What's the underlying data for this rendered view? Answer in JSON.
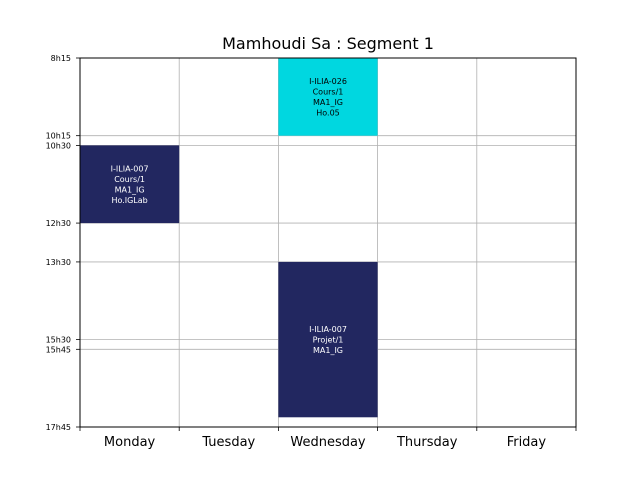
{
  "chart_data": {
    "type": "timetable",
    "title": "Mamhoudi Sa : Segment 1",
    "days": [
      "Monday",
      "Tuesday",
      "Wednesday",
      "Thursday",
      "Friday"
    ],
    "time_ticks": [
      {
        "label": "8h15",
        "minutes": 495
      },
      {
        "label": "10h15",
        "minutes": 615
      },
      {
        "label": "10h30",
        "minutes": 630
      },
      {
        "label": "12h30",
        "minutes": 750
      },
      {
        "label": "13h30",
        "minutes": 810
      },
      {
        "label": "15h30",
        "minutes": 930
      },
      {
        "label": "15h45",
        "minutes": 945
      },
      {
        "label": "17h45",
        "minutes": 1065
      }
    ],
    "ylim": [
      495,
      1065
    ],
    "grid": true,
    "events": [
      {
        "day": "Wednesday",
        "start": "8h15",
        "end": "10h15",
        "start_min": 495,
        "end_min": 615,
        "color": "#00d7e0",
        "text_color": "#000000",
        "lines": [
          "I-ILIA-026",
          "Cours/1",
          "MA1_IG",
          "Ho.05"
        ]
      },
      {
        "day": "Monday",
        "start": "10h30",
        "end": "12h30",
        "start_min": 630,
        "end_min": 750,
        "color": "#222760",
        "text_color": "#ffffff",
        "lines": [
          "I-ILIA-007",
          "Cours/1",
          "MA1_IG",
          "Ho.IGLab"
        ]
      },
      {
        "day": "Wednesday",
        "start": "13h30",
        "end": "17h30",
        "start_min": 810,
        "end_min": 1050,
        "color": "#222760",
        "text_color": "#ffffff",
        "lines": [
          "I-ILIA-007",
          "Projet/1",
          "MA1_IG"
        ]
      }
    ]
  }
}
